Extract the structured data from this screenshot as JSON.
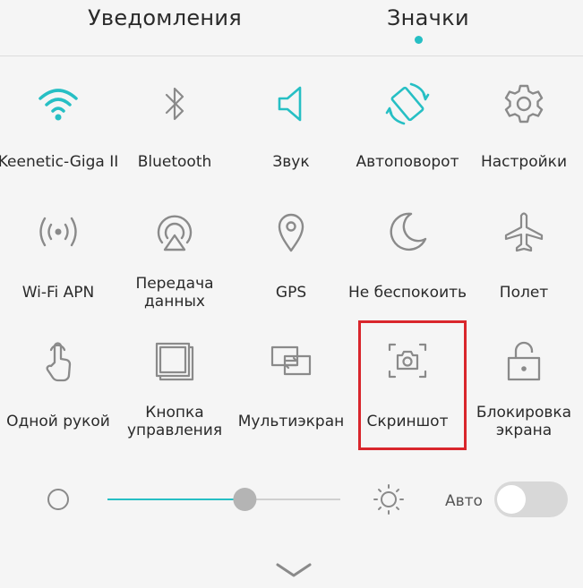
{
  "tabs": {
    "notifications": "Уведомления",
    "icons": "Значки"
  },
  "colors": {
    "accent": "#26bfc4",
    "icon_gray": "#8a8a8a",
    "highlight": "#d9262c",
    "track": "#d0d0d0",
    "toggle_bg": "#d8d8d8"
  },
  "tiles": [
    {
      "label": "Keenetic-Giga II",
      "icon": "wifi-icon",
      "active": true
    },
    {
      "label": "Bluetooth",
      "icon": "bluetooth-icon",
      "active": false
    },
    {
      "label": "Звук",
      "icon": "sound-icon",
      "active": true
    },
    {
      "label": "Автоповорот",
      "icon": "autorotate-icon",
      "active": true
    },
    {
      "label": "Настройки",
      "icon": "settings-gear-icon",
      "active": false
    },
    {
      "label": "Wi-Fi APN",
      "icon": "wifi-hotspot-icon",
      "active": false
    },
    {
      "label": "Передача данных",
      "label_line1": "Передача",
      "label_line2": "данных",
      "icon": "data-transfer-icon",
      "active": false
    },
    {
      "label": "GPS",
      "icon": "location-pin-icon",
      "active": false
    },
    {
      "label": "Не беспокоить",
      "icon": "moon-icon",
      "active": false
    },
    {
      "label": "Полет",
      "icon": "airplane-icon",
      "active": false
    },
    {
      "label": "Одной рукой",
      "icon": "one-hand-icon",
      "active": false
    },
    {
      "label": "Кнопка управления",
      "label_line1": "Кнопка",
      "label_line2": "управления",
      "icon": "navigation-button-icon",
      "active": false
    },
    {
      "label": "Мультиэкран",
      "icon": "multiscreen-icon",
      "active": false
    },
    {
      "label": "Скриншот",
      "icon": "screenshot-camera-icon",
      "active": false
    },
    {
      "label": "Блокировка экрана",
      "label_line1": "Блокировка",
      "label_line2": "экрана",
      "icon": "unlock-icon",
      "active": false
    }
  ],
  "brightness": {
    "level_fraction": 0.59,
    "auto_label": "Авто",
    "auto_enabled": false
  }
}
